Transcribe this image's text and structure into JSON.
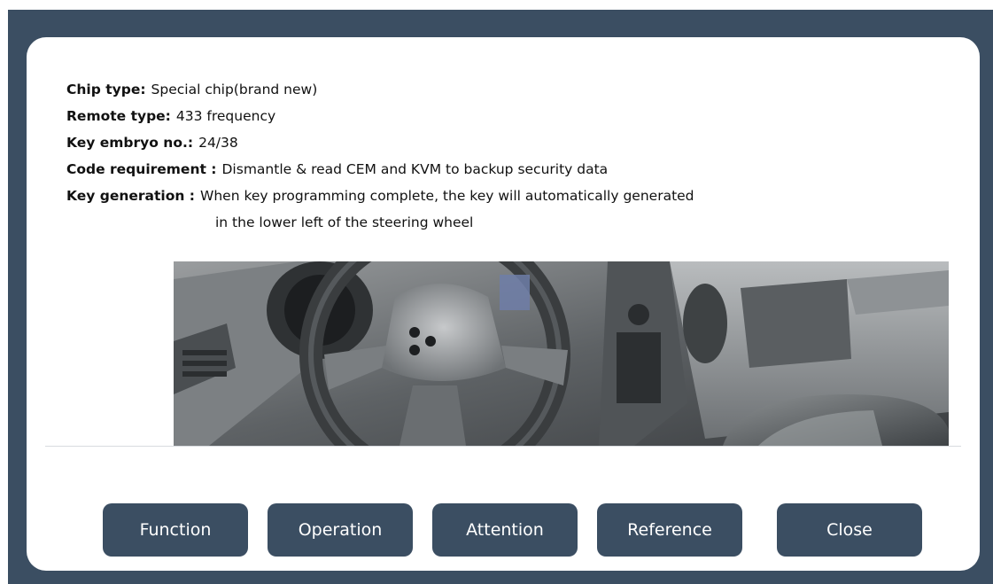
{
  "info": {
    "chip_type": {
      "label": "Chip type:",
      "value": "Special chip(brand new)"
    },
    "remote_type": {
      "label": "Remote type:",
      "value": "433 frequency"
    },
    "key_embryo": {
      "label": "Key embryo no.:",
      "value": "24/38"
    },
    "code_requirement": {
      "label": "Code requirement :",
      "value": "Dismantle & read CEM and KVM to backup security data"
    },
    "key_generation": {
      "label": "Key generation :",
      "value": "When key programming complete, the key will automatically generated",
      "continuation": "in the lower left of the steering wheel"
    }
  },
  "buttons": {
    "function": "Function",
    "operation": "Operation",
    "attention": "Attention",
    "reference": "Reference",
    "close": "Close"
  },
  "colors": {
    "frame": "#3b4e62",
    "button": "#3b4e62",
    "dialog": "#ffffff"
  }
}
